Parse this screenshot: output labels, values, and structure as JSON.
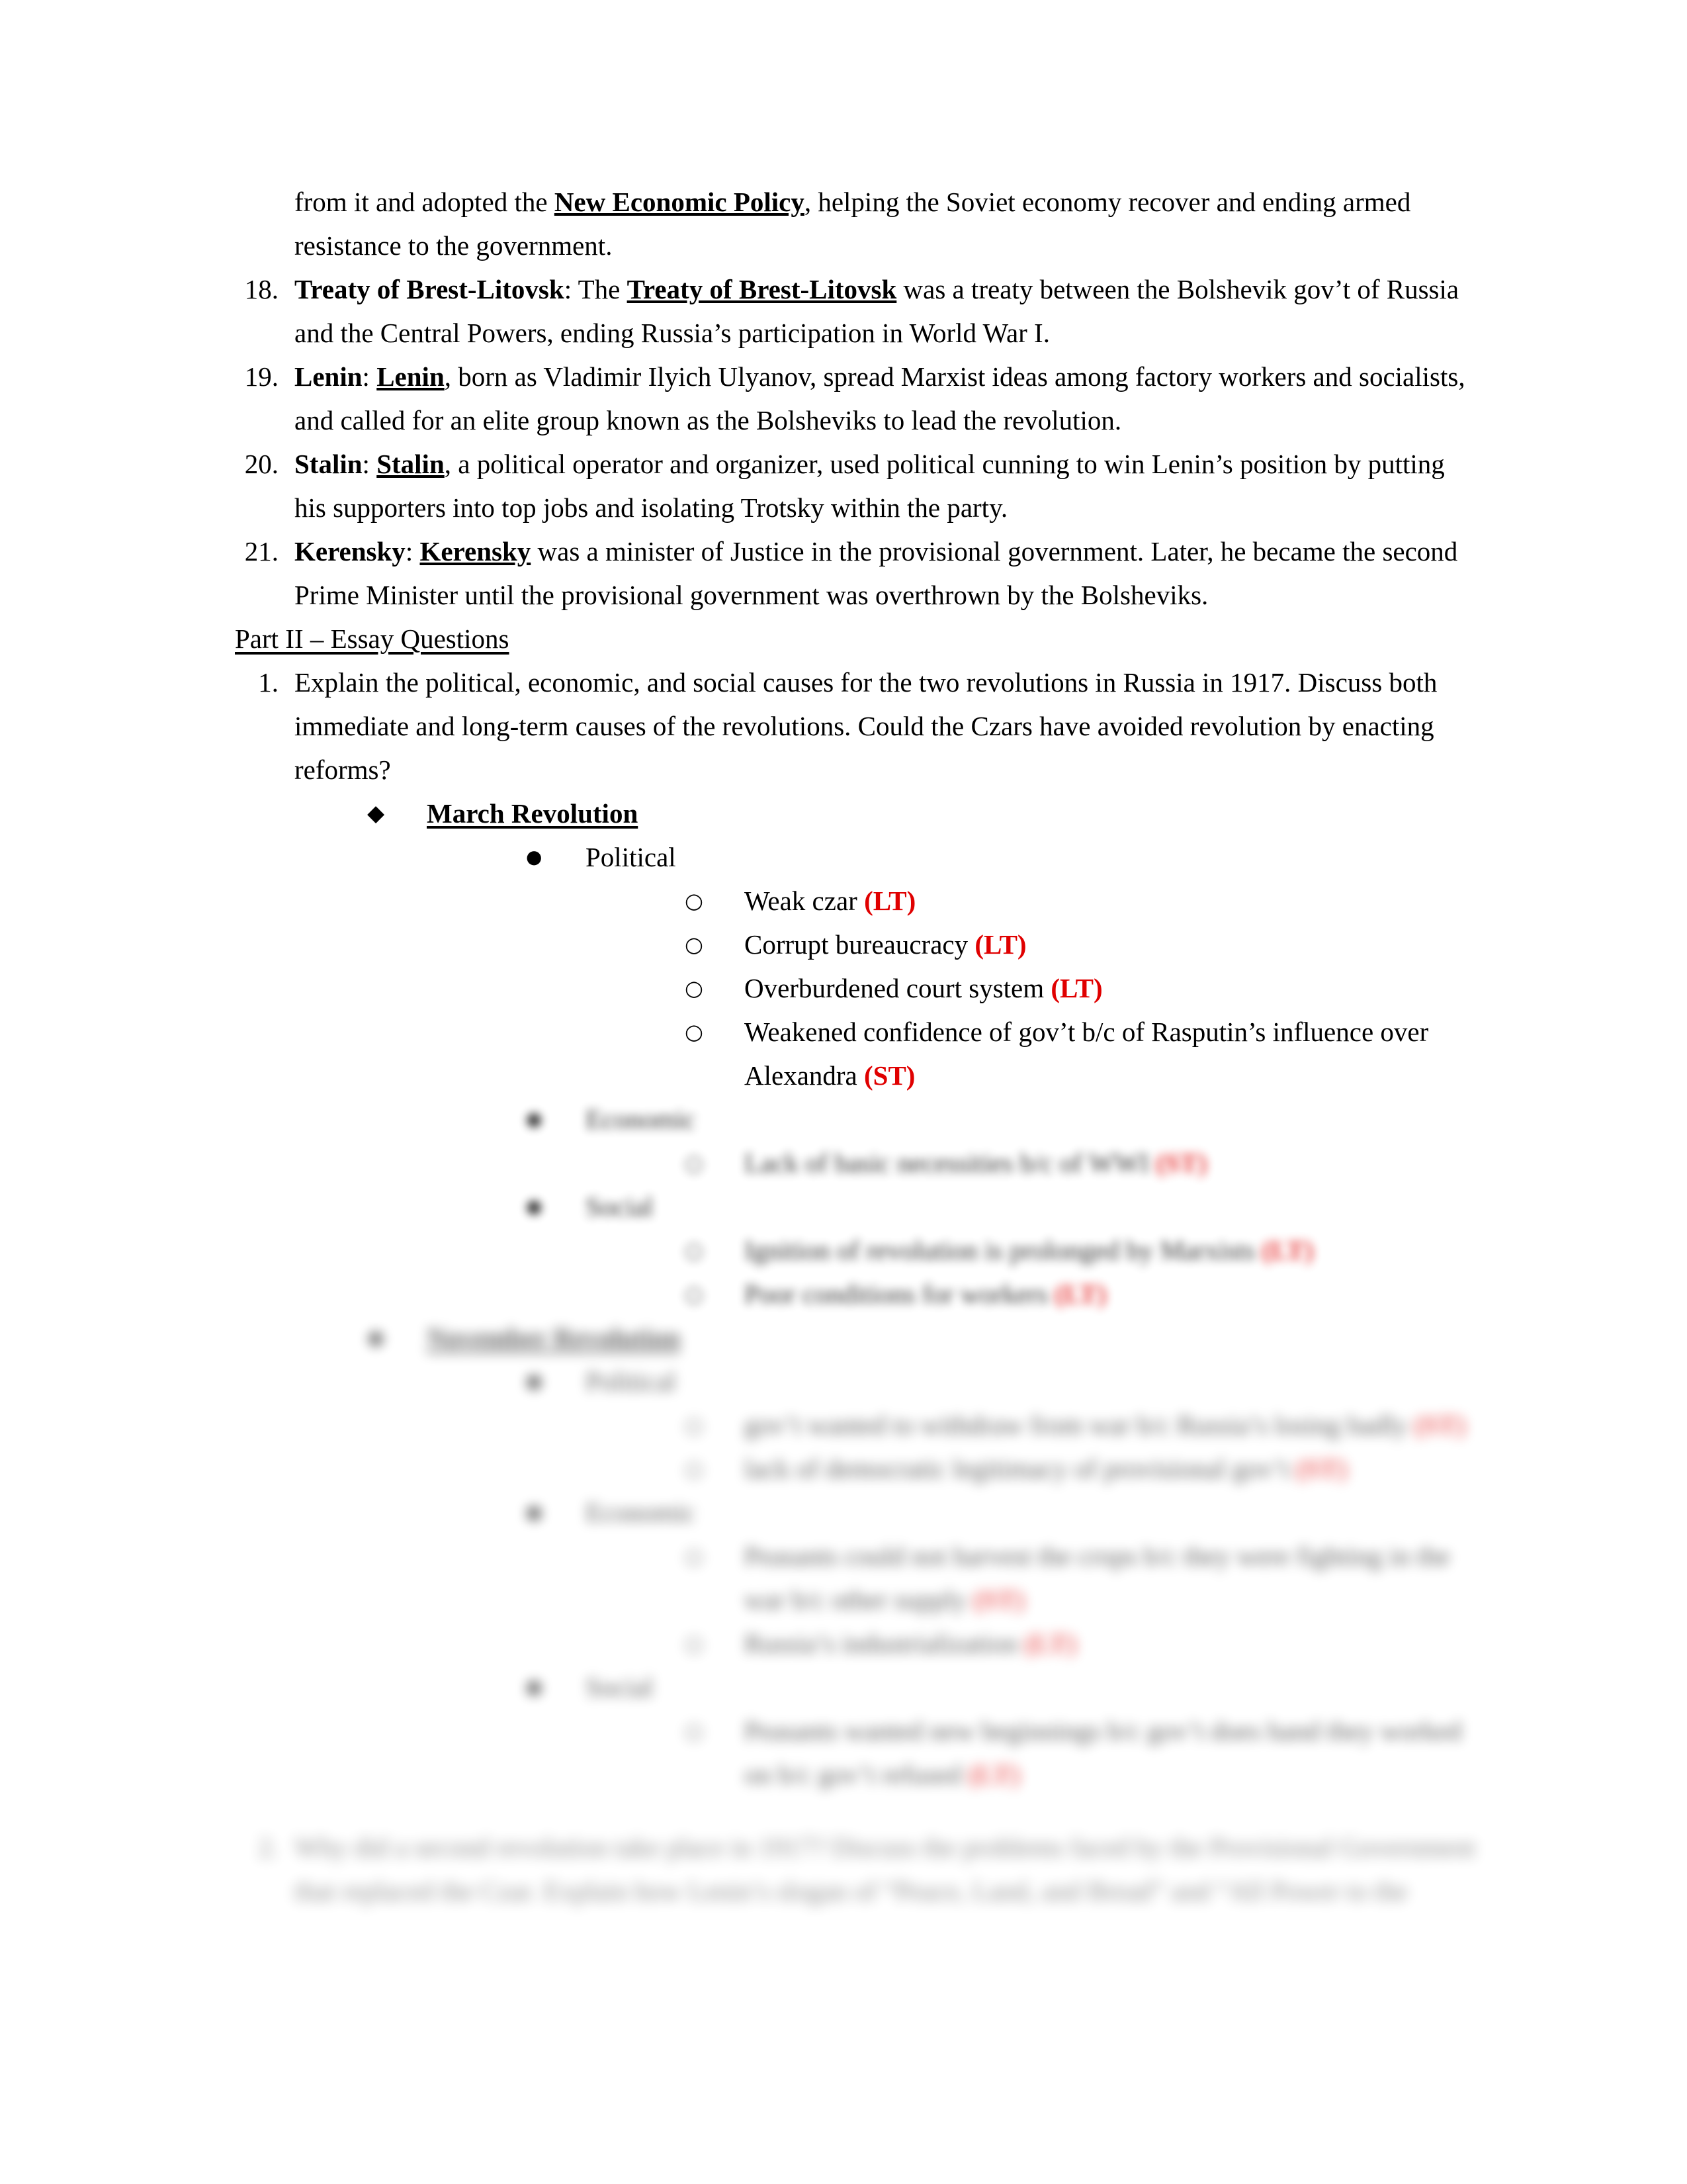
{
  "document": {
    "page_background": "#ffffff",
    "text_color": "#000000",
    "accent_color": "#e00000"
  },
  "continuation_paragraph": {
    "before": "from it and adopted the ",
    "term": "New Economic Policy",
    "after": ", helping the Soviet economy recover and ending armed resistance to the government."
  },
  "definitions": [
    {
      "number": "18.",
      "term": "Treaty of Brest-Litovsk",
      "separator": ": The ",
      "repeat_term": "Treaty of Brest-Litovsk",
      "body": " was a treaty between the Bolshevik gov’t of Russia and the Central Powers, ending Russia’s participation in World War I."
    },
    {
      "number": "19.",
      "term": "Lenin",
      "separator": ": ",
      "repeat_term": "Lenin",
      "body": ", born as Vladimir Ilyich Ulyanov, spread Marxist ideas among factory workers and socialists, and called for an elite group known as the Bolsheviks to lead the revolution."
    },
    {
      "number": "20.",
      "term": "Stalin",
      "separator": ": ",
      "repeat_term": "Stalin",
      "body": ", a political operator and organizer, used political cunning to win Lenin’s position by putting his supporters into top jobs and isolating Trotsky within the party."
    },
    {
      "number": "21.",
      "term": "Kerensky",
      "separator": ": ",
      "repeat_term": "Kerensky",
      "body": " was a minister of Justice in the provisional government. Later, he became the second Prime Minister until the provisional government was overthrown by the Bolsheviks."
    }
  ],
  "part_heading": "Part II –  Essay Questions",
  "essay_questions": [
    {
      "number": "1.",
      "prompt": "Explain the political, economic, and social causes for the two revolutions in Russia in 1917. Discuss both immediate and long-term causes of the revolutions. Could the Czars have avoided revolution by enacting reforms?"
    },
    {
      "number": "2.",
      "prompt": "Why did a second revolution take place in 1917? Discuss the problems faced by the Provisional Government that replaced the Czar. Explain how Lenin’s slogan of “Peace, Land, and Bread” and “All Power to the"
    }
  ],
  "outline": {
    "march_revolution": {
      "bullet": "diamond-bullet",
      "label": "March Revolution",
      "groups": [
        {
          "bullet": "disc-bullet",
          "label": "Political",
          "points": [
            {
              "bullet": "circle-bullet",
              "text": "Weak czar",
              "tag": "(LT)"
            },
            {
              "bullet": "circle-bullet",
              "text": "Corrupt bureaucracy",
              "tag": "(LT)"
            },
            {
              "bullet": "circle-bullet",
              "text": "Overburdened court system",
              "tag": "(LT)"
            },
            {
              "bullet": "circle-bullet",
              "text": "Weakened confidence of gov’t b/c of Rasputin’s influence over Alexandra",
              "tag": "(ST)"
            }
          ]
        },
        {
          "bullet": "disc-bullet",
          "label": "Economic",
          "points": [
            {
              "bullet": "circle-bullet",
              "text": "Lack of basic necessities b/c of WWI",
              "tag": "(ST)"
            }
          ]
        },
        {
          "bullet": "disc-bullet",
          "label": "Social",
          "points": [
            {
              "bullet": "circle-bullet",
              "text": "Ignition of revolution is prolonged by Marxists",
              "tag": "(LT)"
            },
            {
              "bullet": "circle-bullet",
              "text": "Poor conditions for workers",
              "tag": "(LT)"
            }
          ]
        }
      ]
    },
    "november_revolution": {
      "bullet": "diamond-bullet",
      "label": "November Revolution",
      "groups": [
        {
          "bullet": "disc-bullet",
          "label": "Political",
          "points": [
            {
              "bullet": "circle-bullet",
              "text": "gov’t wanted to withdraw from war b/c Russia’s losing badly",
              "tag": "(ST)"
            },
            {
              "bullet": "circle-bullet",
              "text": "lack of democratic legitimacy of provisional gov’t",
              "tag": "(ST)"
            }
          ]
        },
        {
          "bullet": "disc-bullet",
          "label": "Economic",
          "points": [
            {
              "bullet": "circle-bullet",
              "text": "Peasants could not harvest the crops b/c they were fighting in the war b/c other supply",
              "tag": "(ST)"
            },
            {
              "bullet": "circle-bullet",
              "text": "Russia’s industrialization",
              "tag": "(LT)"
            }
          ]
        },
        {
          "bullet": "disc-bullet",
          "label": "Social",
          "points": [
            {
              "bullet": "circle-bullet",
              "text": "Peasants wanted new beginnings b/c gov’t does hand they worked on b/c gov’t refused",
              "tag": "(LT)"
            }
          ]
        }
      ]
    }
  }
}
